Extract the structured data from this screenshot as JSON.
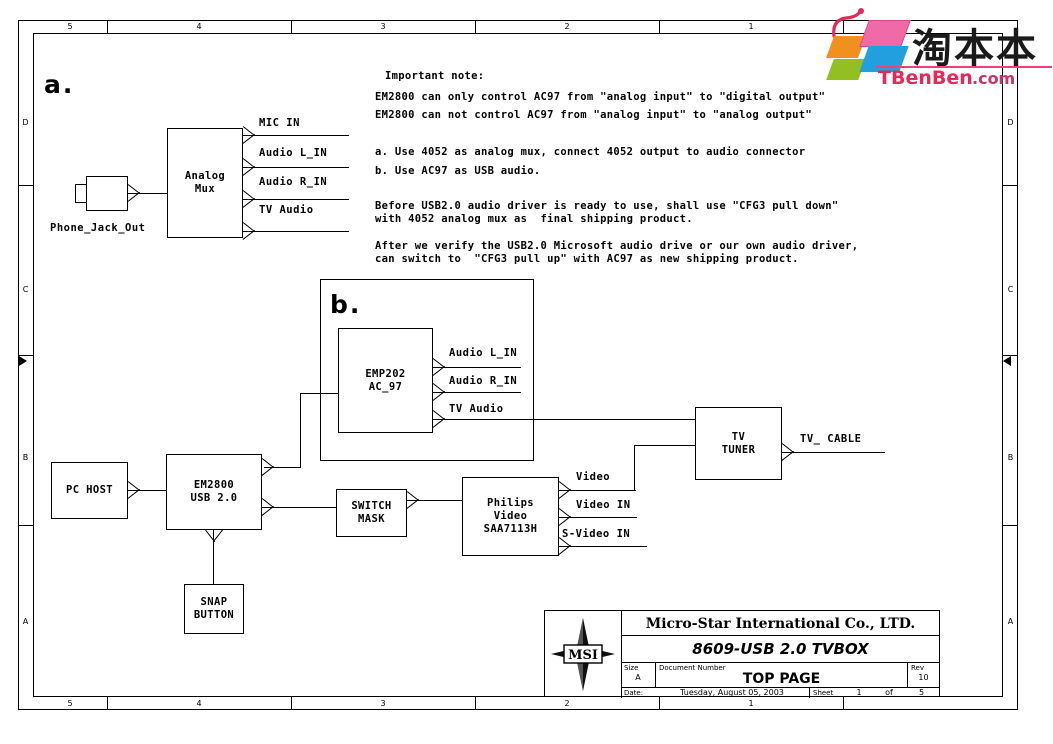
{
  "sheet": {
    "zone_columns": [
      "5",
      "4",
      "3",
      "2",
      "1"
    ],
    "zone_rows": [
      "D",
      "C",
      "B",
      "A"
    ]
  },
  "sections": {
    "a_label": "a.",
    "b_label": "b."
  },
  "notes": {
    "heading": "Important note:",
    "lines": [
      "EM2800 can only control AC97 from \"analog input\" to \"digital output\"",
      "EM2800 can not control AC97 from \"analog input\" to \"analog output\"",
      "a. Use 4052 as analog mux, connect 4052 output to audio connector",
      "b. Use AC97 as USB audio.",
      "Before USB2.0 audio driver is ready to use, shall use \"CFG3 pull down\"",
      "with 4052 analog mux as  final shipping product.",
      "After we verify the USB2.0 Microsoft audio drive or our own audio driver,",
      "can switch to  \"CFG3 pull up\" with AC97 as new shipping product."
    ]
  },
  "blocks": {
    "analog_mux": {
      "line1": "Analog",
      "line2": "Mux"
    },
    "phone_jack": {
      "label": "Phone_Jack_Out"
    },
    "emp202": {
      "line1": "EMP202",
      "line2": "AC_97"
    },
    "em2800": {
      "line1": "EM2800",
      "line2": "USB 2.0"
    },
    "pc_host": {
      "label": "PC HOST"
    },
    "snap_button": {
      "line1": "SNAP",
      "line2": "BUTTON"
    },
    "switch_mask": {
      "line1": "SWITCH",
      "line2": "MASK"
    },
    "philips": {
      "line1": "Philips",
      "line2": "Video",
      "line3": "SAA7113H"
    },
    "tv_tuner": {
      "line1": "TV",
      "line2": "TUNER"
    }
  },
  "signals": {
    "mic_in": "MIC IN",
    "audio_l_in": "Audio L_IN",
    "audio_r_in": "Audio R_IN",
    "tv_audio": "TV Audio",
    "b_audio_l_in": "Audio L_IN",
    "b_audio_r_in": "Audio R_IN",
    "b_tv_audio": "TV Audio",
    "video": "Video",
    "video_in": "Video IN",
    "s_video_in": "S-Video IN",
    "tv_cable": "TV_ CABLE"
  },
  "title_block": {
    "company": "Micro-Star International Co., LTD.",
    "project": "8609-USB 2.0 TVBOX",
    "size_label": "Size",
    "size_value": "A",
    "docnum_label": "Document Number",
    "docnum_value": "TOP PAGE",
    "rev_label": "Rev",
    "rev_value": "10",
    "date_label": "Date:",
    "date_value": "Tuesday, August 05, 2003",
    "sheet_label": "Sheet",
    "sheet_num": "1",
    "sheet_of": "of",
    "sheet_total": "5",
    "logo_text": "MSI"
  },
  "watermark": {
    "cn_text": "淘本本",
    "domain_main": "TBenBen",
    "domain_suffix": ".com",
    "color_red": "#e8275a",
    "color_pink": "#f06aa8",
    "color_orange": "#f0901e",
    "color_blue": "#22a0dd",
    "color_green": "#93c020"
  }
}
